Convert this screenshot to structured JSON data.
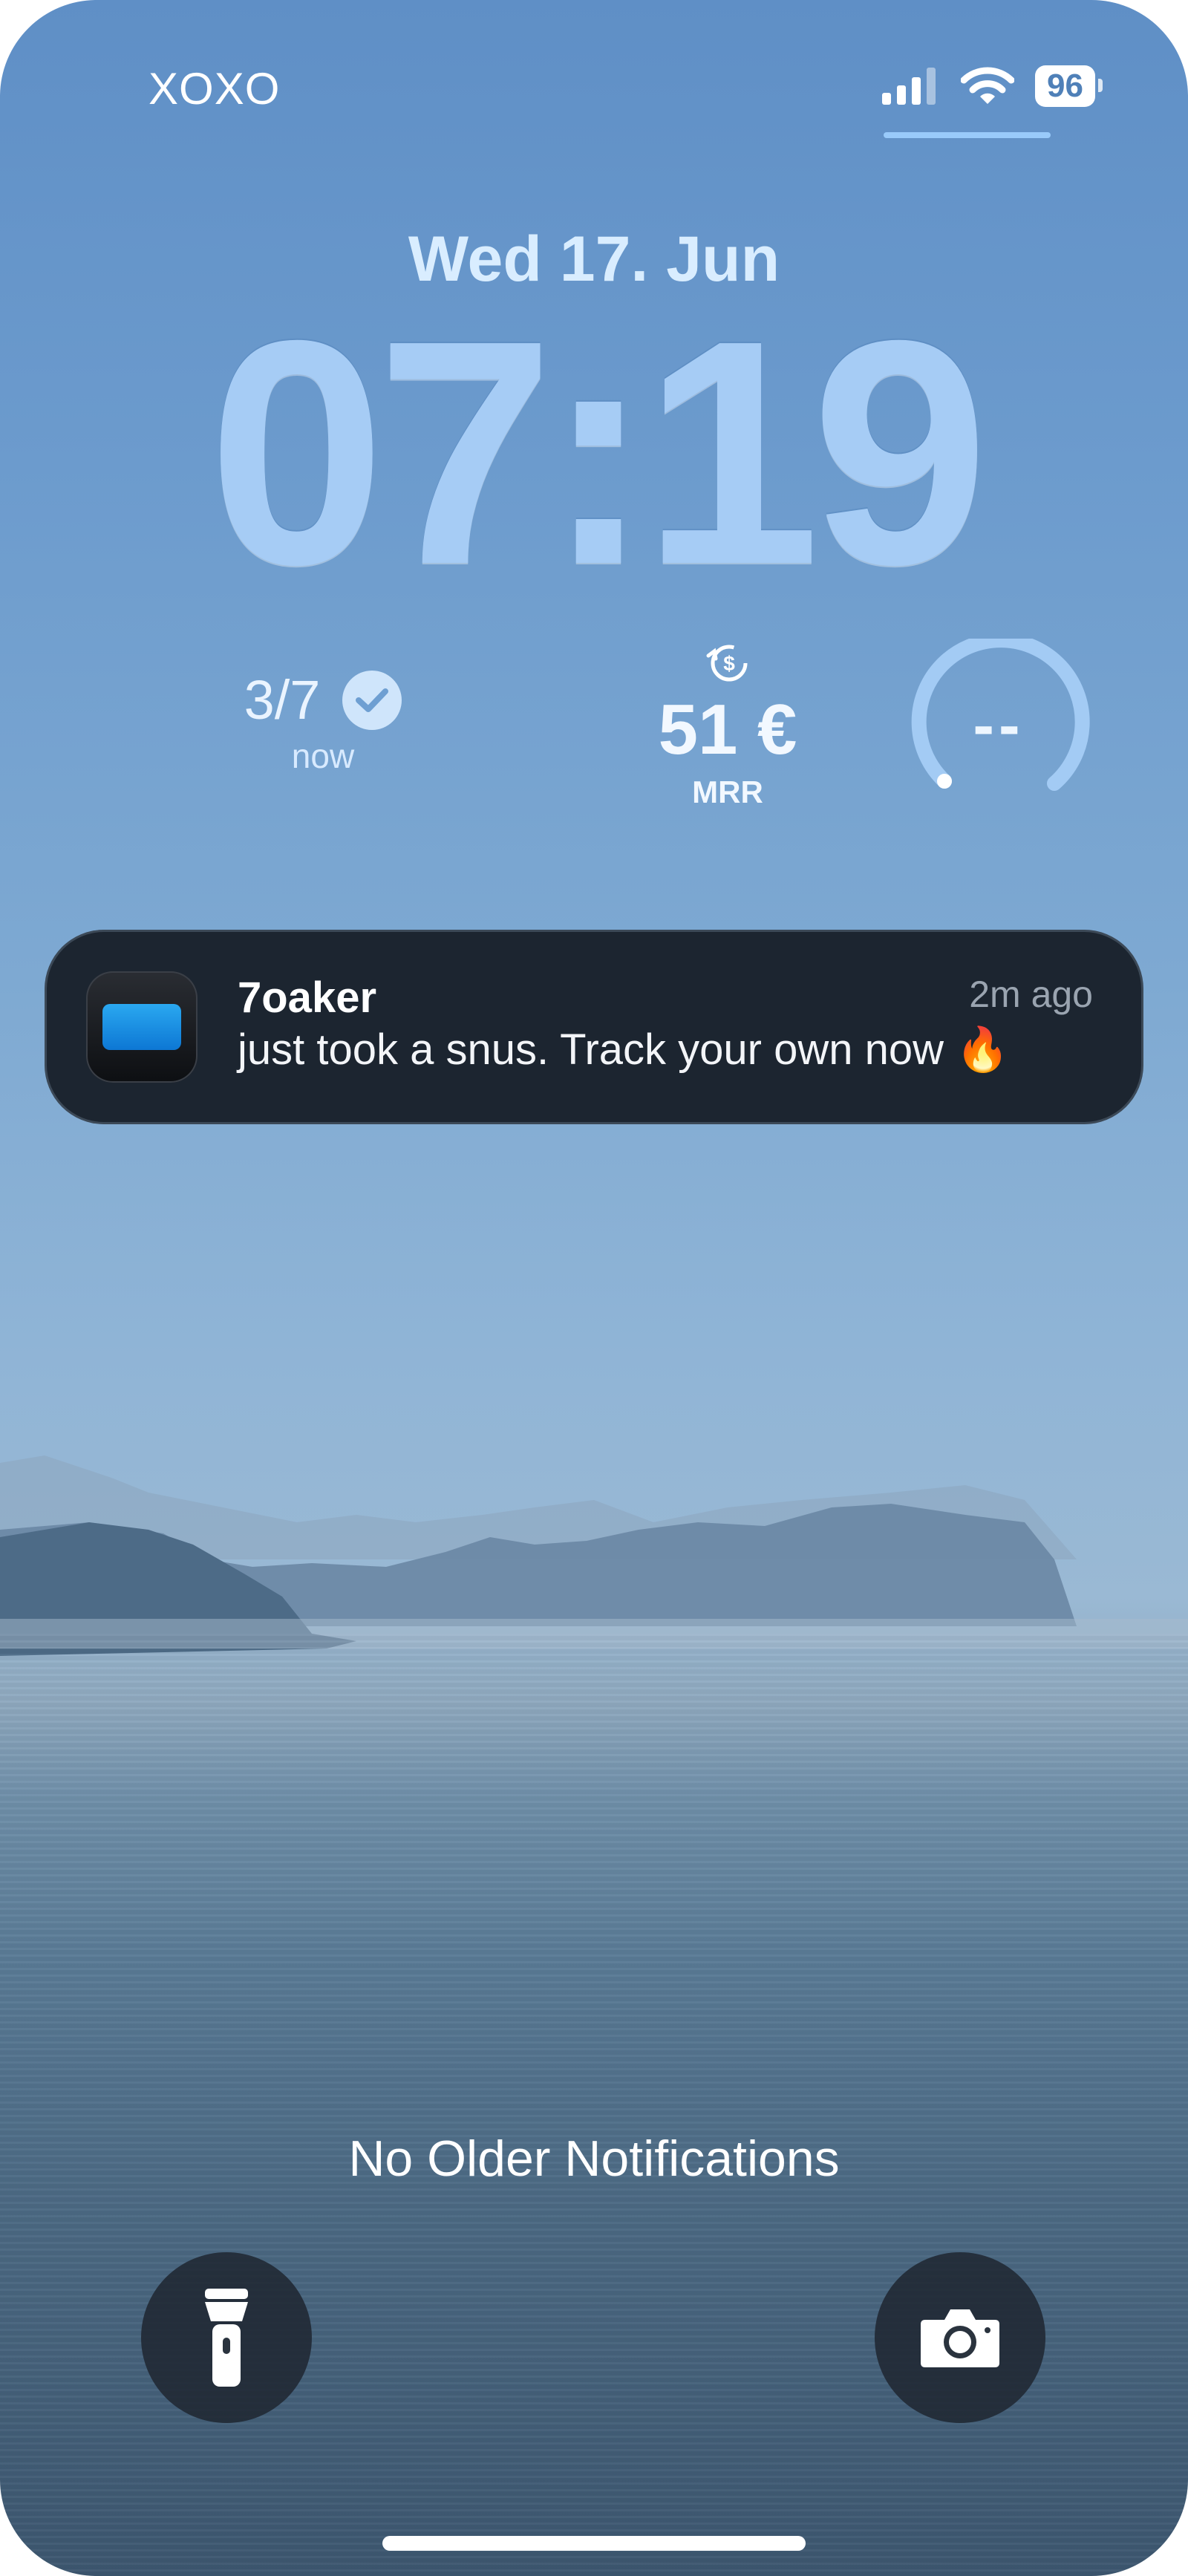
{
  "status_bar": {
    "carrier": "XOXO",
    "battery": "96"
  },
  "lock_screen": {
    "date": "Wed 17. Jun",
    "time": "07:19"
  },
  "widgets": {
    "tasks": {
      "value": "3/7",
      "label": "now"
    },
    "revenue": {
      "value": "51 €",
      "label": "MRR"
    },
    "gauge": {
      "value": "--"
    }
  },
  "notification": {
    "app_name": "7oaker",
    "time": "2m ago",
    "message": "just took a snus. Track your own now 🔥"
  },
  "footer": {
    "no_older_text": "No Older Notifications"
  },
  "quick_actions": {
    "left_icon": "flashlight-icon",
    "right_icon": "camera-icon"
  }
}
